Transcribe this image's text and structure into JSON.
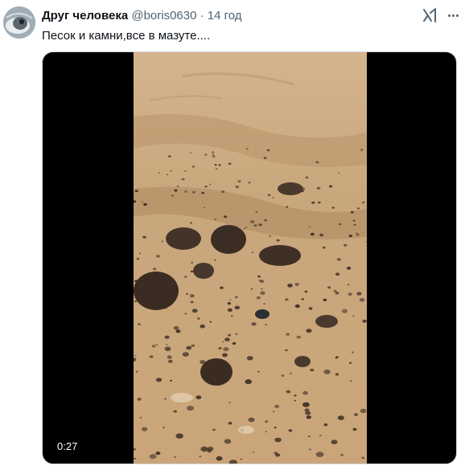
{
  "author": {
    "name": "Друг человека",
    "handle": "@boris0630",
    "separator": "·",
    "time": "14 год"
  },
  "icons": {
    "grok": "grok-icon",
    "more": "more-icon",
    "avatar": "avatar-image"
  },
  "tweet": {
    "text": "Песок и камни,все в мазуте...."
  },
  "video": {
    "duration": "0:27"
  },
  "colors": {
    "name": "#0f1419",
    "secondary": "#536471",
    "border": "#cfd9de",
    "sand": "#c9a47a",
    "rock": "#3e2f24"
  }
}
